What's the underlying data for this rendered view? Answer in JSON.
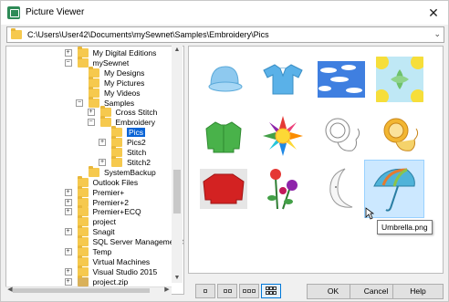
{
  "window": {
    "title": "Picture Viewer",
    "close_glyph": "✕"
  },
  "path": {
    "value": "C:\\Users\\User42\\Documents\\mySewnet\\Samples\\Embroidery\\Pics"
  },
  "tree": {
    "items": [
      {
        "label": "My Digital Editions",
        "expander": "+"
      },
      {
        "label": "mySewnet",
        "expander": "−"
      },
      {
        "label": "My Designs",
        "expander": ""
      },
      {
        "label": "My Pictures",
        "expander": ""
      },
      {
        "label": "My Videos",
        "expander": ""
      },
      {
        "label": "Samples",
        "expander": "−"
      },
      {
        "label": "Cross Stitch",
        "expander": "+"
      },
      {
        "label": "Embroidery",
        "expander": "−"
      },
      {
        "label": "Pics",
        "expander": ""
      },
      {
        "label": "Pics2",
        "expander": "+"
      },
      {
        "label": "Stitch",
        "expander": ""
      },
      {
        "label": "Stitch2",
        "expander": "+"
      },
      {
        "label": "SystemBackup",
        "expander": ""
      },
      {
        "label": "Outlook Files",
        "expander": ""
      },
      {
        "label": "Premier+",
        "expander": "+"
      },
      {
        "label": "Premier+2",
        "expander": "+"
      },
      {
        "label": "Premier+ECQ",
        "expander": "+"
      },
      {
        "label": "project",
        "expander": ""
      },
      {
        "label": "Snagit",
        "expander": "+"
      },
      {
        "label": "SQL Server Management St",
        "expander": ""
      },
      {
        "label": "Temp",
        "expander": "+"
      },
      {
        "label": "Virtual Machines",
        "expander": ""
      },
      {
        "label": "Visual Studio 2015",
        "expander": "+"
      },
      {
        "label": "project.zip",
        "expander": "+"
      }
    ]
  },
  "gallery": {
    "thumbnails": [
      {
        "name": "cap-thumbnail"
      },
      {
        "name": "polo-shirt-thumbnail"
      },
      {
        "name": "sky-clouds-thumbnail"
      },
      {
        "name": "lemons-pattern-thumbnail"
      },
      {
        "name": "green-jacket-thumbnail"
      },
      {
        "name": "rainbow-sun-thumbnail"
      },
      {
        "name": "lion-outline-thumbnail"
      },
      {
        "name": "lion-color-thumbnail"
      },
      {
        "name": "red-sweater-thumbnail"
      },
      {
        "name": "flowers-thumbnail"
      },
      {
        "name": "moon-thumbnail"
      },
      {
        "name": "umbrella-thumbnail"
      }
    ],
    "tooltip": "Umbrella.png"
  },
  "buttons": {
    "ok": "OK",
    "cancel": "Cancel",
    "help": "Help"
  },
  "colors": {
    "selection": "#0a64d6",
    "folder": "#f6c94e",
    "thumb_selected_bg": "#cce8ff"
  }
}
